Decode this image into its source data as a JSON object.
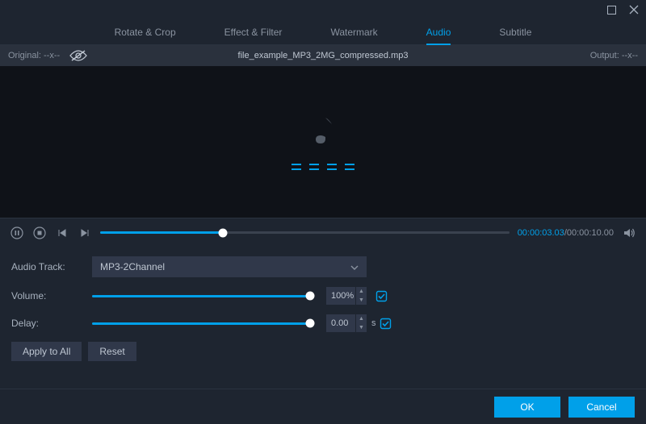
{
  "tabs": {
    "items": [
      {
        "label": "Rotate & Crop"
      },
      {
        "label": "Effect & Filter"
      },
      {
        "label": "Watermark"
      },
      {
        "label": "Audio"
      },
      {
        "label": "Subtitle"
      }
    ],
    "active_index": 3
  },
  "infobar": {
    "original_label": "Original: --x--",
    "filename": "file_example_MP3_2MG_compressed.mp3",
    "output_label": "Output: --x--"
  },
  "playback": {
    "current_time": "00:00:03.03",
    "duration": "00:00:10.00",
    "separator": "/",
    "progress_pct": 30
  },
  "settings": {
    "audio_track": {
      "label": "Audio Track:",
      "value": "MP3-2Channel"
    },
    "volume": {
      "label": "Volume:",
      "value": "100%",
      "pct": 100
    },
    "delay": {
      "label": "Delay:",
      "value": "0.00",
      "unit": "s",
      "pct": 100
    }
  },
  "buttons": {
    "apply_all": "Apply to All",
    "reset": "Reset",
    "ok": "OK",
    "cancel": "Cancel"
  }
}
